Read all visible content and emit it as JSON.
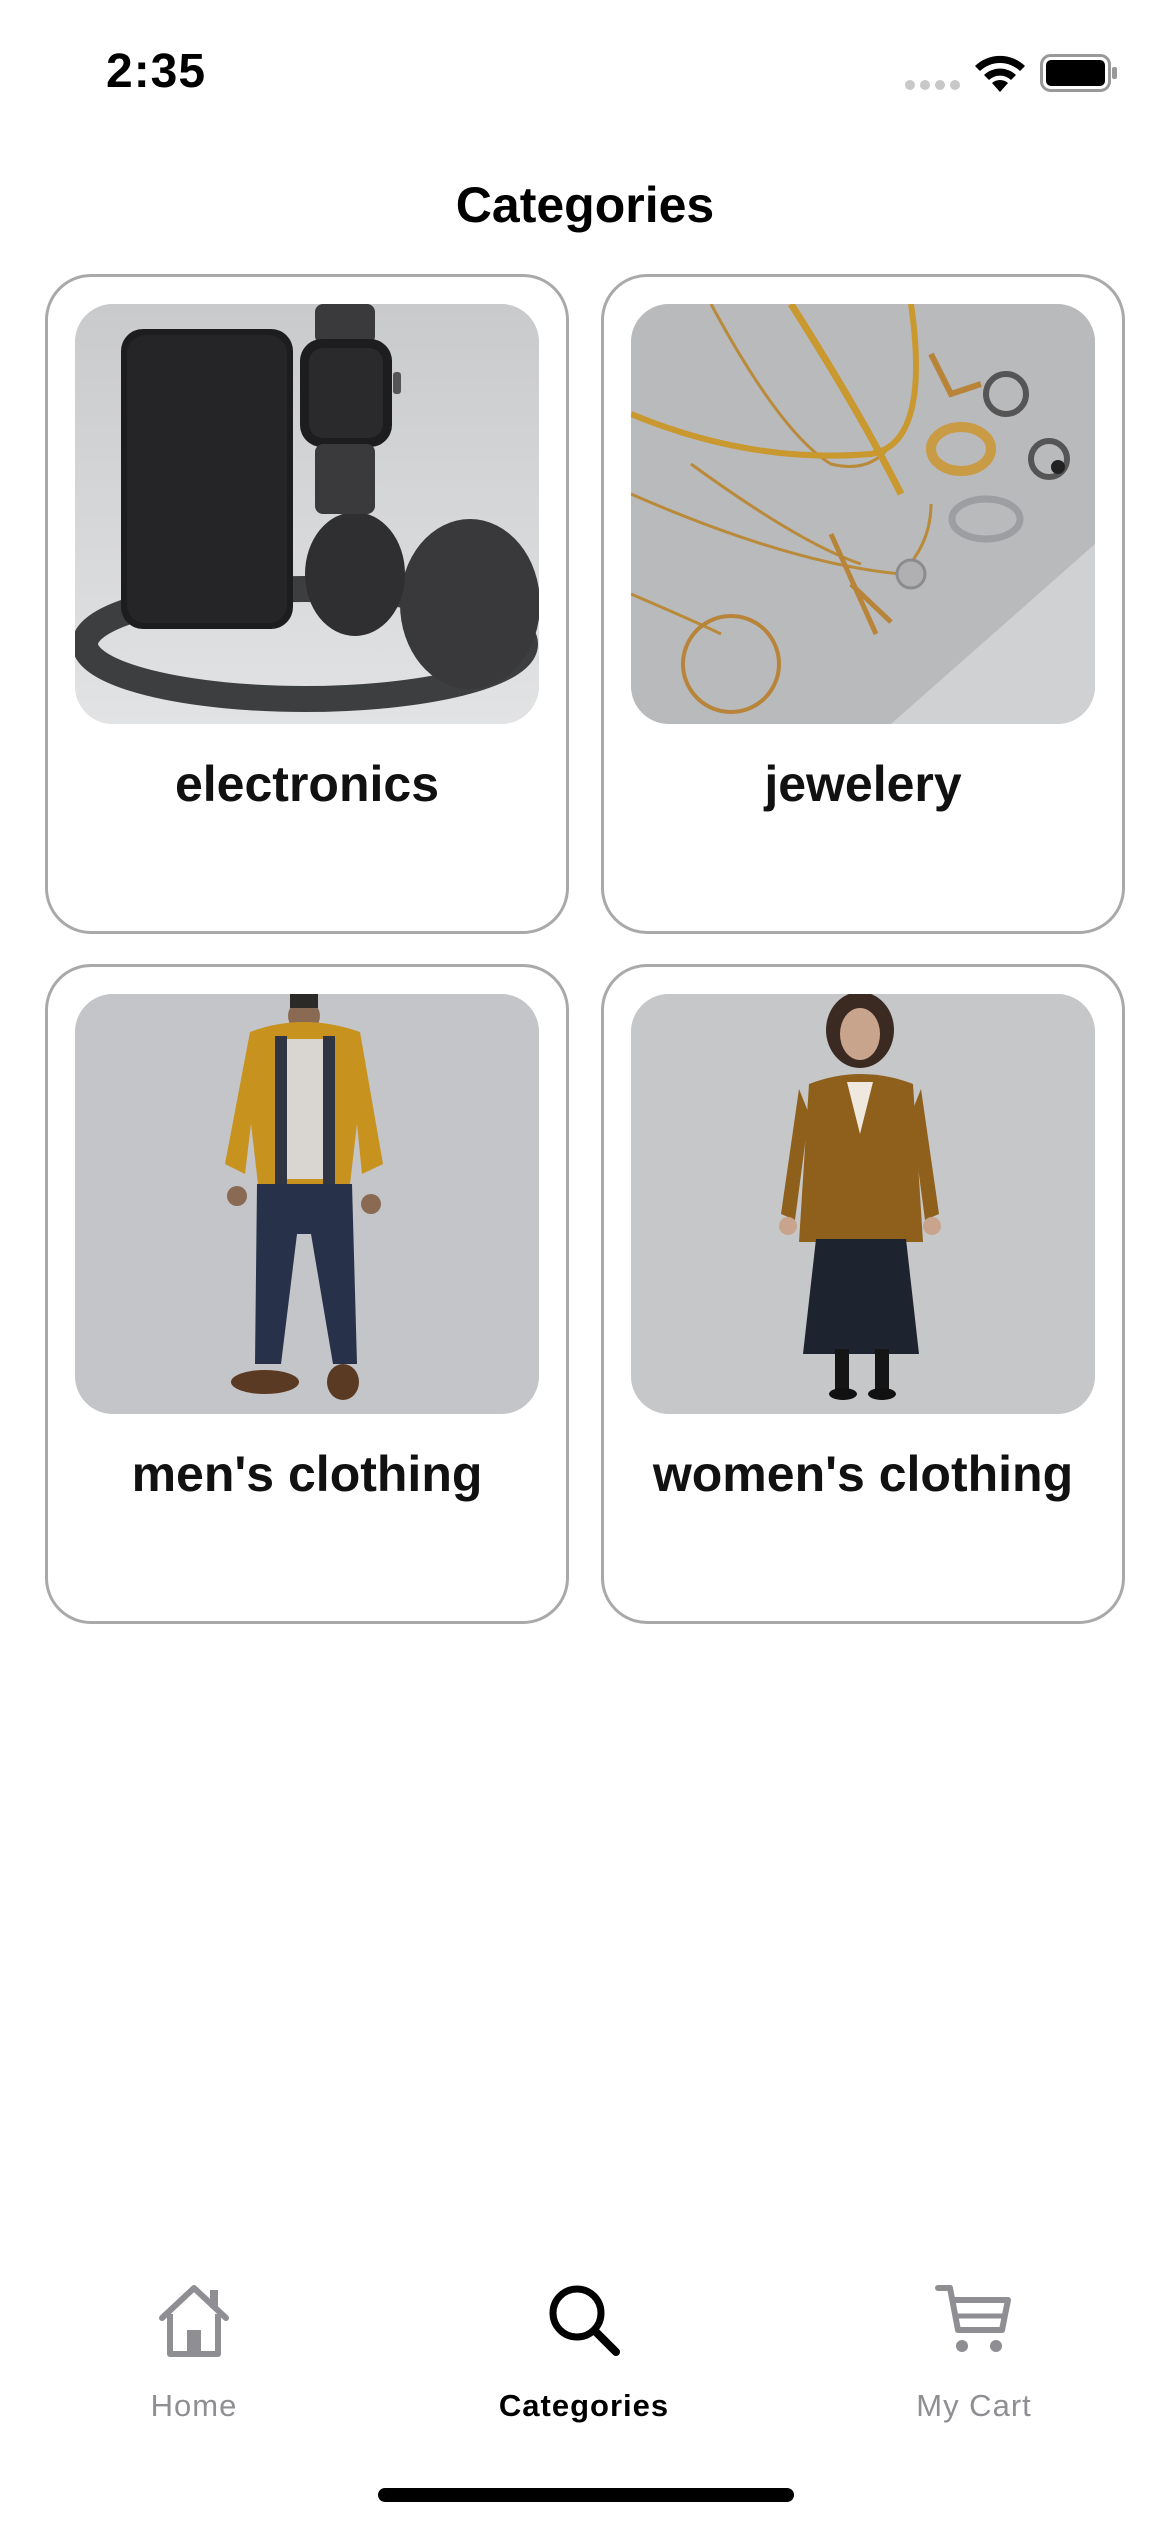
{
  "status_bar": {
    "time": "2:35"
  },
  "header": {
    "title": "Categories"
  },
  "categories": [
    {
      "name": "electronics",
      "image_icon": "electronics-photo"
    },
    {
      "name": "jewelery",
      "image_icon": "jewelery-photo"
    },
    {
      "name": "men's clothing",
      "image_icon": "mens-clothing-photo"
    },
    {
      "name": "women's clothing",
      "image_icon": "womens-clothing-photo"
    }
  ],
  "tab_bar": {
    "items": [
      {
        "label": "Home",
        "icon": "home-icon",
        "active": false
      },
      {
        "label": "Categories",
        "icon": "search-icon",
        "active": true
      },
      {
        "label": "My Cart",
        "icon": "cart-icon",
        "active": false
      }
    ]
  },
  "colors": {
    "active": "#000000",
    "inactive": "#8e8e93",
    "card_border": "#a9a9a9"
  }
}
